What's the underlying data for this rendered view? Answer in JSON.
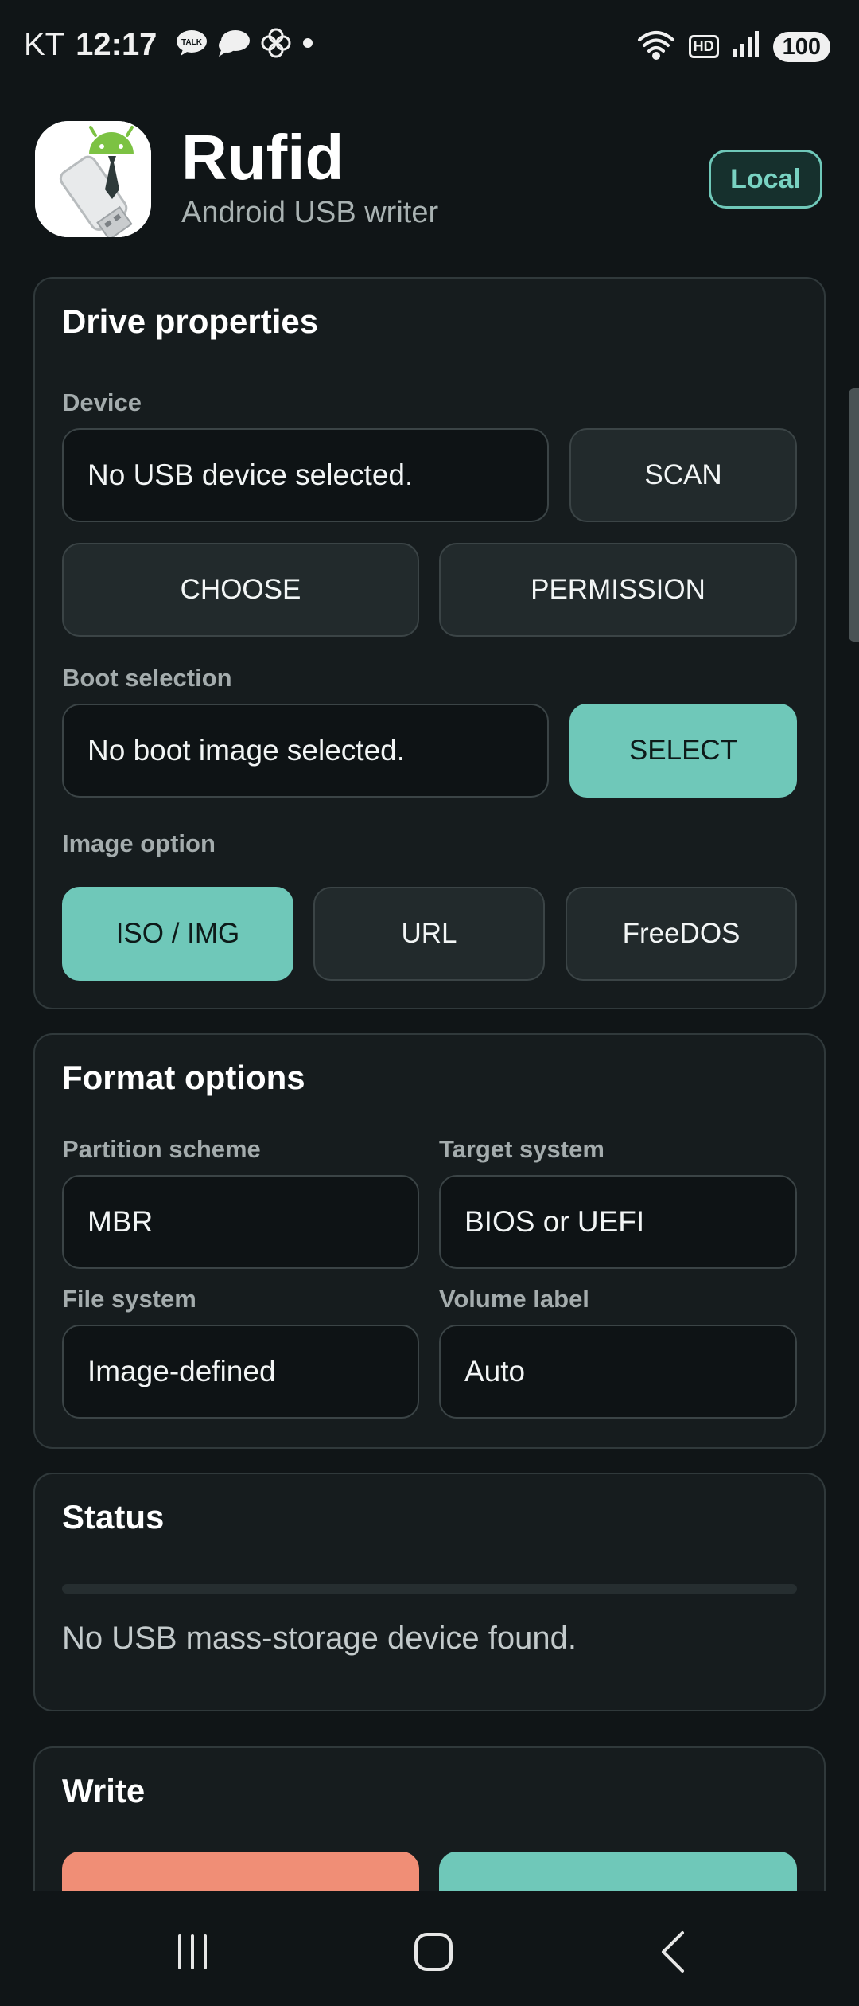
{
  "status_bar": {
    "carrier": "KT",
    "time": "12:17",
    "hd_label": "HD",
    "battery": "100",
    "icons": [
      "talk-icon",
      "chat-bubble-icon",
      "pinwheel-icon",
      "dot-icon",
      "wifi-icon",
      "hd-icon",
      "signal-icon",
      "battery-icon"
    ]
  },
  "header": {
    "title": "Rufid",
    "subtitle": "Android USB writer",
    "badge": "Local"
  },
  "drive_properties": {
    "title": "Drive properties",
    "device_label": "Device",
    "device_value": "No USB device selected.",
    "scan_button": "SCAN",
    "choose_button": "CHOOSE",
    "permission_button": "PERMISSION",
    "boot_label": "Boot selection",
    "boot_value": "No boot image selected.",
    "select_button": "SELECT",
    "image_option_label": "Image option",
    "image_options": [
      "ISO / IMG",
      "URL",
      "FreeDOS"
    ],
    "image_option_selected": "ISO / IMG"
  },
  "format_options": {
    "title": "Format options",
    "partition_label": "Partition scheme",
    "partition_value": "MBR",
    "target_label": "Target system",
    "target_value": "BIOS or UEFI",
    "fs_label": "File system",
    "fs_value": "Image-defined",
    "volume_label": "Volume label",
    "volume_value": "Auto"
  },
  "status": {
    "title": "Status",
    "progress": 0,
    "message": "No USB mass-storage device found."
  },
  "write": {
    "title": "Write"
  },
  "colors": {
    "accent": "#6fc8b9",
    "danger": "#f08e76",
    "background": "#101517",
    "card": "#161c1e"
  },
  "nav": {
    "icons": [
      "recent-apps-icon",
      "home-icon",
      "back-icon"
    ]
  }
}
